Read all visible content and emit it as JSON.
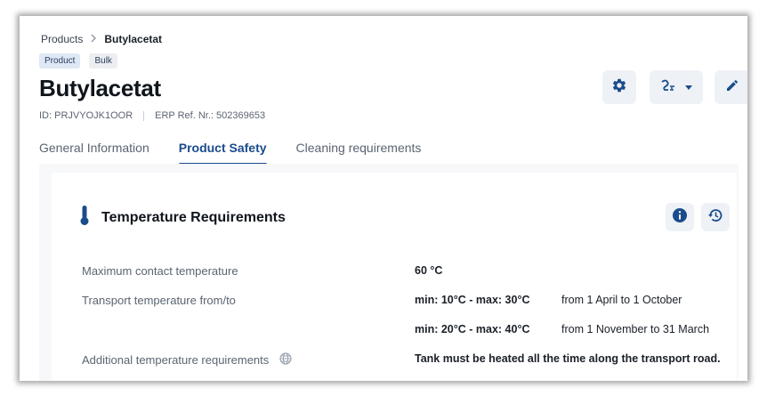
{
  "breadcrumb": {
    "parent": "Products",
    "separator": ">",
    "current": "Butylacetat"
  },
  "tags": {
    "product": "Product",
    "bulk": "Bulk"
  },
  "header": {
    "title": "Butylacetat",
    "id_text": "ID: PRJVYOJK1OOR",
    "erp_text": "ERP Ref. Nr.: 502369653",
    "actions": {
      "settings": "gear-icon",
      "workflow": "route-icon",
      "edit": "pencil-icon"
    }
  },
  "tabs": [
    {
      "label": "General Information",
      "active": false
    },
    {
      "label": "Product Safety",
      "active": true
    },
    {
      "label": "Cleaning requirements",
      "active": false
    }
  ],
  "section": {
    "title": "Temperature Requirements",
    "icon": "thermometer-icon",
    "rows": [
      {
        "label": "Maximum contact temperature",
        "value": "60 °C"
      },
      {
        "label": "Transport temperature from/to",
        "value": "min: 10°C - max: 30°C",
        "period": "from 1 April to 1 October"
      },
      {
        "label": "",
        "value": "min: 20°C - max: 40°C",
        "period": "from 1 November to 31 March"
      },
      {
        "label": "Additional temperature requirements",
        "value": "Tank must be heated all the time along the transport road."
      }
    ]
  },
  "colors": {
    "accent": "#1a4b8c",
    "button_bg": "#eef1f5",
    "muted_text": "#5b6472"
  }
}
